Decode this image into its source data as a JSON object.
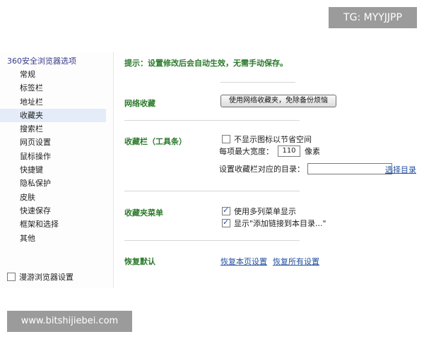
{
  "sidebar": {
    "title": "360安全浏览器选项",
    "items": [
      {
        "label": "常规"
      },
      {
        "label": "标签栏"
      },
      {
        "label": "地址栏"
      },
      {
        "label": "收藏夹"
      },
      {
        "label": "搜索栏"
      },
      {
        "label": "网页设置"
      },
      {
        "label": "鼠标操作"
      },
      {
        "label": "快捷键"
      },
      {
        "label": "隐私保护"
      },
      {
        "label": "皮肤"
      },
      {
        "label": "快速保存"
      },
      {
        "label": "框架和选择"
      },
      {
        "label": "其他"
      }
    ],
    "active_index": 3,
    "sync_label": "漫游浏览器设置"
  },
  "main": {
    "tip": "提示：设置修改后会自动生效，无需手动保存。",
    "net_fav": {
      "label": "网络收藏",
      "button": "使用网络收藏夹，免除备份烦恼"
    },
    "fav_bar": {
      "label": "收藏栏（工具条）",
      "hide_icon_label": "不显示图标以节省空间",
      "hide_icon_checked": false,
      "max_width_label": "每项最大宽度：",
      "max_width_value": "110",
      "max_width_unit": "像素",
      "dir_label": "设置收藏栏对应的目录：",
      "dir_value": "",
      "choose_dir": "选择目录"
    },
    "fav_menu": {
      "label": "收藏夹菜单",
      "multi_col_label": "使用多列菜单显示",
      "multi_col_checked": true,
      "add_link_label": "显示\"添加链接到本目录...\"",
      "add_link_checked": true
    },
    "restore": {
      "label": "恢复默认",
      "restore_page": "恢复本页设置",
      "restore_all": "恢复所有设置"
    }
  },
  "overlays": {
    "tg_badge": "TG: MYYJJPP",
    "watermark": "www.bitshijiebei.com"
  }
}
